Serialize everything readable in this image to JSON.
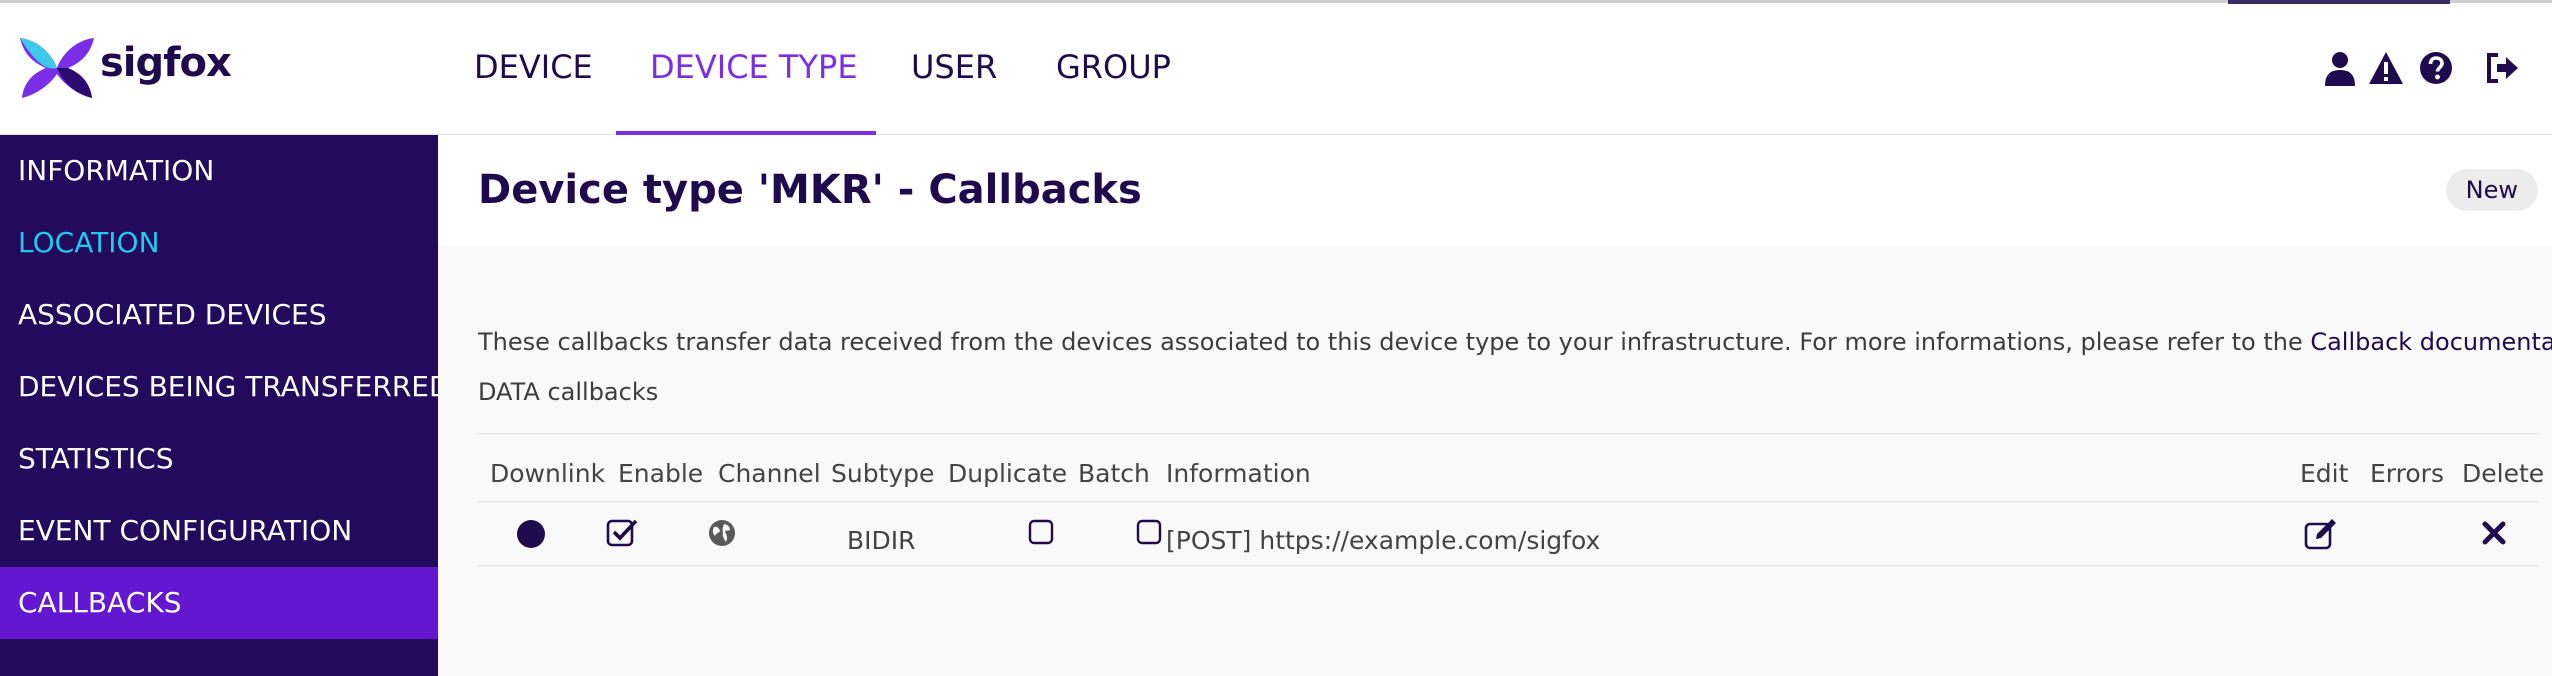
{
  "brand": {
    "name": "sigfox"
  },
  "nav": {
    "items": [
      {
        "label": "DEVICE"
      },
      {
        "label": "DEVICE TYPE"
      },
      {
        "label": "USER"
      },
      {
        "label": "GROUP"
      }
    ],
    "active_index": 1
  },
  "header_icons": [
    "user-icon",
    "warning-icon",
    "help-icon",
    "logout-icon"
  ],
  "sidebar": {
    "items": [
      {
        "label": "INFORMATION"
      },
      {
        "label": "LOCATION"
      },
      {
        "label": "ASSOCIATED DEVICES"
      },
      {
        "label": "DEVICES BEING TRANSFERRED"
      },
      {
        "label": "STATISTICS"
      },
      {
        "label": "EVENT CONFIGURATION"
      },
      {
        "label": "CALLBACKS"
      }
    ],
    "active": "CALLBACKS",
    "highlighted": "LOCATION"
  },
  "page": {
    "title": "Device type 'MKR' - Callbacks",
    "new_label": "New",
    "intro_text": "These callbacks transfer data received from the devices associated to this device type to your infrastructure. For more informations, please refer to the ",
    "intro_link": "Callback documentation",
    "section_label": "DATA callbacks"
  },
  "table": {
    "headers": {
      "downlink": "Downlink",
      "enable": "Enable",
      "channel": "Channel",
      "subtype": "Subtype",
      "duplicate": "Duplicate",
      "batch": "Batch",
      "information": "Information",
      "edit": "Edit",
      "errors": "Errors",
      "delete": "Delete"
    },
    "rows": [
      {
        "downlink": "active",
        "enable": true,
        "channel": "url",
        "subtype": "BIDIR",
        "duplicate": false,
        "batch": false,
        "information": "[POST] https://example.com/sigfox",
        "errors": ""
      }
    ]
  },
  "colors": {
    "brand_dark": "#1f0a4d",
    "accent_purple": "#7a2ee8",
    "sidebar_bg": "#230a5c",
    "sidebar_active": "#6417d0",
    "sidebar_highlight_text": "#1ecbf0"
  }
}
